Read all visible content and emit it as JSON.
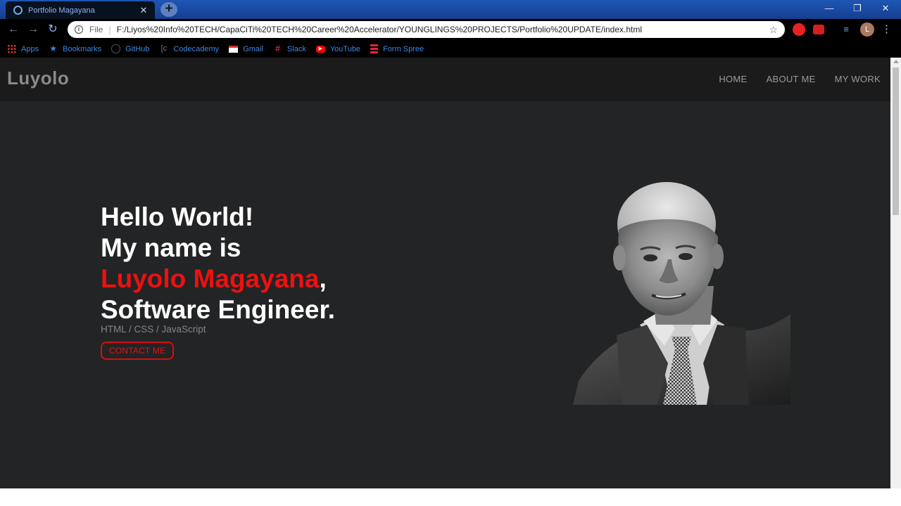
{
  "browser": {
    "tab_title": "Portfolio Magayana",
    "tab_close": "✕",
    "new_tab": "+",
    "window_controls": {
      "minimize": "—",
      "restore": "❐",
      "close": "✕"
    },
    "omnibox": {
      "scheme": "File",
      "url": "F:/Liyos%20Info%20TECH/CapaCiTi%20TECH%20Career%20Accelerator/YOUNGLINGS%20PROJECTS/Portfolio%20UPDATE/index.html"
    },
    "profile_initial": "L",
    "bookmarks": [
      {
        "label": "Apps",
        "icon": "apps-grid-icon"
      },
      {
        "label": "Bookmarks",
        "icon": "star-icon"
      },
      {
        "label": "GitHub",
        "icon": "github-icon"
      },
      {
        "label": "Codecademy",
        "icon": "codecademy-icon"
      },
      {
        "label": "Gmail",
        "icon": "gmail-icon"
      },
      {
        "label": "Slack",
        "icon": "slack-icon"
      },
      {
        "label": "YouTube",
        "icon": "youtube-icon"
      },
      {
        "label": "Form Spree",
        "icon": "formspree-icon"
      }
    ]
  },
  "site": {
    "brand": "Luyolo",
    "nav": [
      "HOME",
      "ABOUT ME",
      "MY WORK"
    ],
    "hero": {
      "line1": "Hello World!",
      "line2": "My name is",
      "name": "Luyolo Magayana",
      "comma": ",",
      "line4": "Software Engineer.",
      "skills": "HTML / CSS / JavaScript",
      "cta": "CONTACT ME"
    }
  },
  "colors": {
    "page_bg": "#232425",
    "header_bg": "#1b1b1c",
    "accent_red": "#ec1111",
    "tabbar_blue": "#1e56b5"
  }
}
